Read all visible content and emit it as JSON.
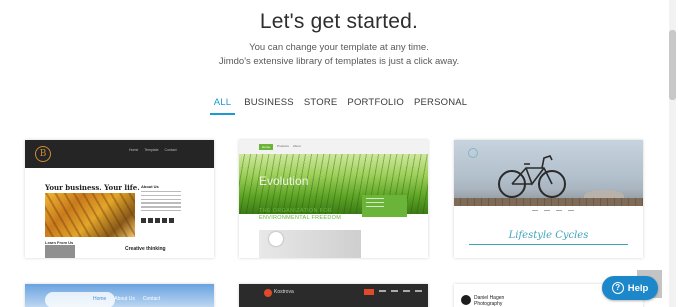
{
  "header": {
    "title": "Let's get started.",
    "subtitle_line1": "You can change your template at any time.",
    "subtitle_line2": "Jimdo's extensive library of templates is just a click away."
  },
  "tabs": [
    {
      "label": "ALL",
      "active": true
    },
    {
      "label": "BUSINESS",
      "active": false
    },
    {
      "label": "STORE",
      "active": false
    },
    {
      "label": "PORTFOLIO",
      "active": false
    },
    {
      "label": "PERSONAL",
      "active": false
    }
  ],
  "templates": {
    "business": {
      "logo_letter": "B",
      "nav": [
        "Home",
        "Template",
        "Contact"
      ],
      "headline": "Your business. Your life.",
      "about": "About Us",
      "learn": "Learn From Us",
      "creative": "Creative thinking"
    },
    "evolution": {
      "nav_active": "Home",
      "nav": [
        "Products",
        "About"
      ],
      "brand": "Evolution",
      "tagline_line1": "THE ORGANIZATION FOR",
      "tagline_line2": "ENVIRONMENTAL FREEDOM"
    },
    "lifestyle": {
      "title": "Lifestyle Cycles"
    },
    "sky": {
      "nav": [
        "Home",
        "About Us",
        "Contact"
      ]
    },
    "dark": {
      "brand": "Kostrova"
    },
    "photography": {
      "name_line1": "Daniel Hagen",
      "name_line2": "Photography"
    }
  },
  "help_button": {
    "label": "Help",
    "icon": "question-icon",
    "color": "#1c87c9"
  },
  "colors": {
    "accent": "#1a9ad6",
    "evolution_green": "#6bb43a",
    "lifestyle_teal": "#3fa4bb"
  }
}
